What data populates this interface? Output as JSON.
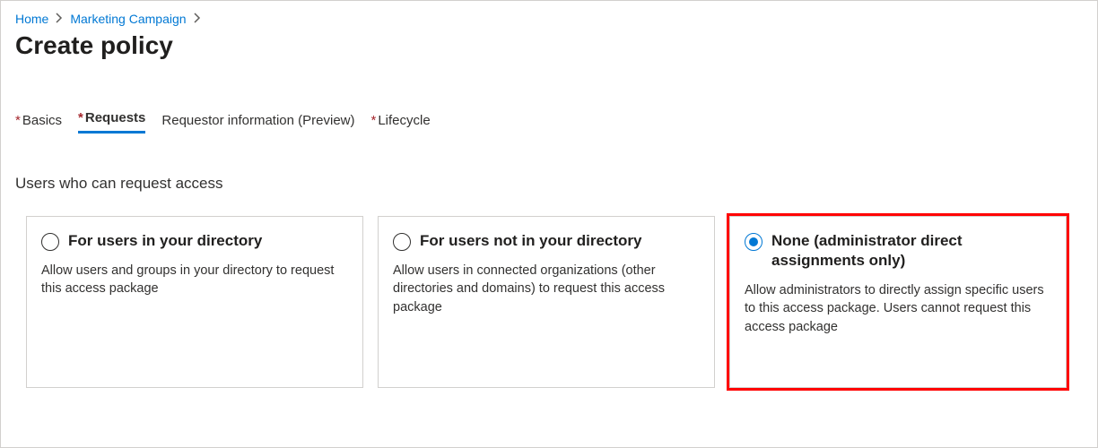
{
  "breadcrumb": {
    "items": [
      "Home",
      "Marketing Campaign"
    ]
  },
  "pageTitle": "Create policy",
  "tabs": [
    {
      "label": "Basics",
      "required": true,
      "selected": false
    },
    {
      "label": "Requests",
      "required": true,
      "selected": true
    },
    {
      "label": "Requestor information (Preview)",
      "required": false,
      "selected": false
    },
    {
      "label": "Lifecycle",
      "required": true,
      "selected": false
    }
  ],
  "sectionLabel": "Users who can request access",
  "options": [
    {
      "title": "For users in your directory",
      "desc": "Allow users and groups in your directory to request this access package",
      "selected": false,
      "highlighted": false
    },
    {
      "title": "For users not in your directory",
      "desc": "Allow users in connected organizations (other directories and domains) to request this access package",
      "selected": false,
      "highlighted": false
    },
    {
      "title": "None (administrator direct assignments only)",
      "desc": "Allow administrators to directly assign specific users to this access package. Users cannot request this access package",
      "selected": true,
      "highlighted": true
    }
  ]
}
